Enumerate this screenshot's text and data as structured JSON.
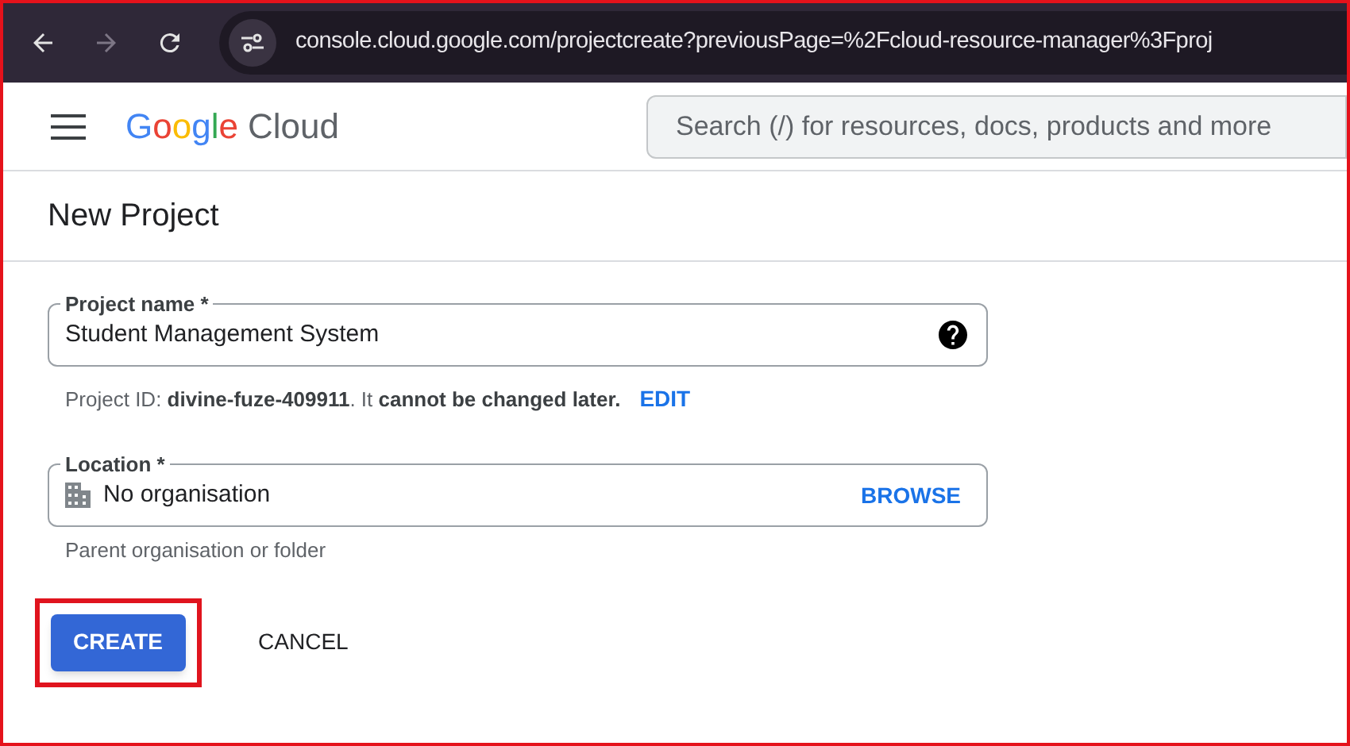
{
  "browser": {
    "url": "console.cloud.google.com/projectcreate?previousPage=%2Fcloud-resource-manager%3Fproj"
  },
  "header": {
    "logo_word": "Google",
    "logo_product": "Cloud",
    "search": {
      "placeholder": "Search (/) for resources, docs, products and more"
    }
  },
  "page_title": "New Project",
  "project_name": {
    "label": "Project name *",
    "value": "Student Management System"
  },
  "project_id_hint": {
    "text": "Project ID: **divine-fuze-409911**. It **cannot be changed later.**",
    "action": "EDIT"
  },
  "location": {
    "label": "Location *",
    "value": "No organisation",
    "action": "BROWSE",
    "hint": "Parent organisation or folder"
  },
  "buttons": [
    {
      "label": "CREATE",
      "kind": "primary",
      "highlighted": true
    },
    {
      "label": "CANCEL",
      "kind": "text",
      "highlighted": false
    }
  ]
}
